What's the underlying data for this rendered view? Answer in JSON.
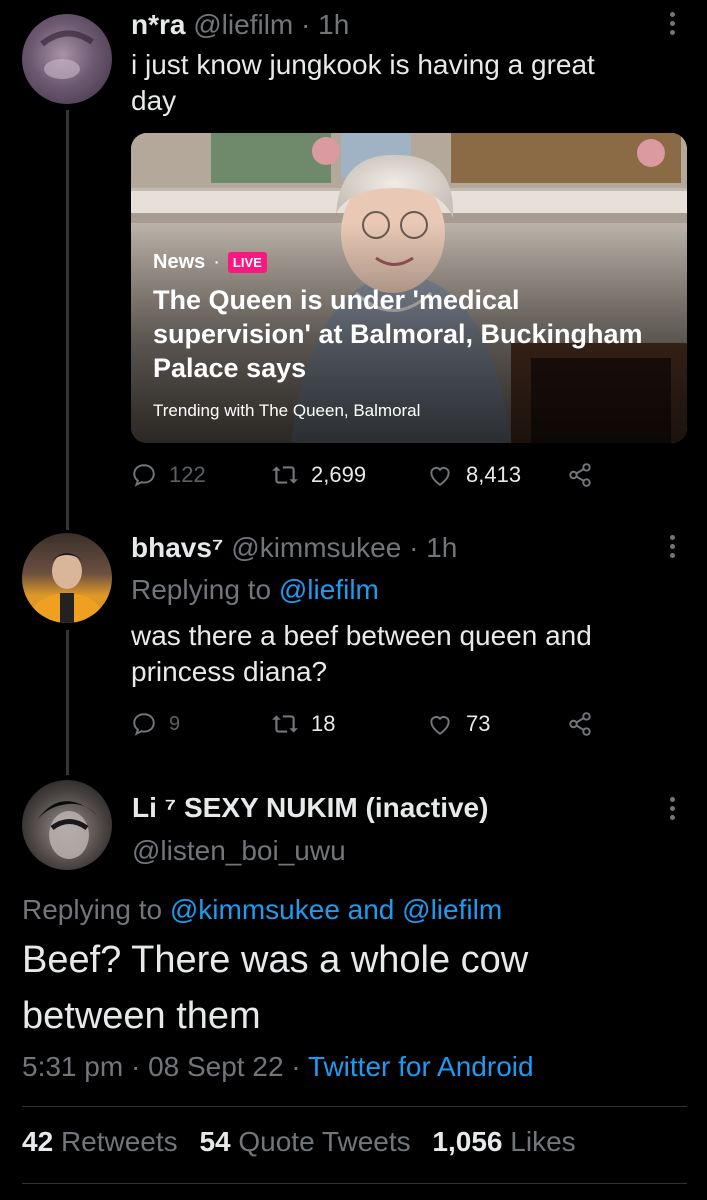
{
  "tweet1": {
    "display_name": "n*ra",
    "handle": "@liefilm",
    "time": "1h",
    "text_line1": "i just know jungkook is having a great",
    "text_line2": "day",
    "card": {
      "source": "News",
      "live_badge": "LIVE",
      "title": "The Queen is under 'medical supervision' at Balmoral, Buckingham Palace says",
      "trending": "Trending with The Queen, Balmoral"
    },
    "replies": "122",
    "retweets": "2,699",
    "likes": "8,413"
  },
  "tweet2": {
    "display_name": "bhavs⁷",
    "handle": "@kimmsukee",
    "time": "1h",
    "replying_prefix": "Replying to",
    "replying_to": "@liefilm",
    "text_line1": "was there a beef between queen and",
    "text_line2": "princess diana?",
    "replies": "9",
    "retweets": "18",
    "likes": "73"
  },
  "main_tweet": {
    "display_name": "Li ⁷ SEXY NUKIM (inactive)",
    "handle": "@listen_boi_uwu",
    "replying_prefix": "Replying to",
    "replying_to": "@kimmsukee and @liefilm",
    "text_line1": "Beef? There was a whole cow",
    "text_line2": "between them",
    "time": "5:31 pm",
    "date": "08 Sept 22",
    "client": "Twitter for Android",
    "retweets_count": "42",
    "retweets_label": "Retweets",
    "quotes_count": "54",
    "quotes_label": "Quote Tweets",
    "likes_count": "1,056",
    "likes_label": "Likes"
  },
  "icons": {
    "reply": "reply-icon",
    "retweet": "retweet-icon",
    "like": "heart-icon",
    "share": "share-icon",
    "more": "more-icon"
  },
  "colors": {
    "background": "#000000",
    "link": "#1d9bf0",
    "muted": "#71767b",
    "live": "#f91880"
  }
}
